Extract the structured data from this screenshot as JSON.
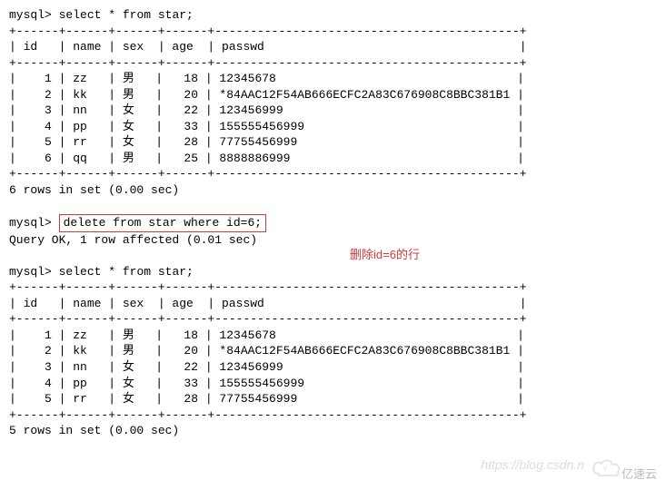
{
  "prompt": "mysql>",
  "queries": {
    "select1": "select * from star;",
    "delete": "delete from star where id=6;",
    "select2": "select * from star;"
  },
  "border": "+------+------+------+------+-------------------------------------------+",
  "header": "| id   | name | sex  | age  | passwd                                    |",
  "table1_rows": [
    "|    1 | zz   | 男   |   18 | 12345678                                  |",
    "|    2 | kk   | 男   |   20 | *84AAC12F54AB666ECFC2A83C676908C8BBC381B1 |",
    "|    3 | nn   | 女   |   22 | 123456999                                 |",
    "|    4 | pp   | 女   |   33 | 155555456999                              |",
    "|    5 | rr   | 女   |   28 | 77755456999                               |",
    "|    6 | qq   | 男   |   25 | 8888886999                                |"
  ],
  "result1": "6 rows in set (0.00 sec)",
  "delete_result": "Query OK, 1 row affected (0.01 sec)",
  "table2_rows": [
    "|    1 | zz   | 男   |   18 | 12345678                                  |",
    "|    2 | kk   | 男   |   20 | *84AAC12F54AB666ECFC2A83C676908C8BBC381B1 |",
    "|    3 | nn   | 女   |   22 | 123456999                                 |",
    "|    4 | pp   | 女   |   33 | 155555456999                              |",
    "|    5 | rr   | 女   |   28 | 77755456999                               |"
  ],
  "result2": "5 rows in set (0.00 sec)",
  "annotation": "删除id=6的行",
  "watermark_text": "https://blog.csdn.n",
  "watermark_logo": "亿速云",
  "chart_data": {
    "type": "table",
    "title": "star",
    "columns": [
      "id",
      "name",
      "sex",
      "age",
      "passwd"
    ],
    "before_delete": [
      {
        "id": 1,
        "name": "zz",
        "sex": "男",
        "age": 18,
        "passwd": "12345678"
      },
      {
        "id": 2,
        "name": "kk",
        "sex": "男",
        "age": 20,
        "passwd": "*84AAC12F54AB666ECFC2A83C676908C8BBC381B1"
      },
      {
        "id": 3,
        "name": "nn",
        "sex": "女",
        "age": 22,
        "passwd": "123456999"
      },
      {
        "id": 4,
        "name": "pp",
        "sex": "女",
        "age": 33,
        "passwd": "155555456999"
      },
      {
        "id": 5,
        "name": "rr",
        "sex": "女",
        "age": 28,
        "passwd": "77755456999"
      },
      {
        "id": 6,
        "name": "qq",
        "sex": "男",
        "age": 25,
        "passwd": "8888886999"
      }
    ],
    "after_delete": [
      {
        "id": 1,
        "name": "zz",
        "sex": "男",
        "age": 18,
        "passwd": "12345678"
      },
      {
        "id": 2,
        "name": "kk",
        "sex": "男",
        "age": 20,
        "passwd": "*84AAC12F54AB666ECFC2A83C676908C8BBC381B1"
      },
      {
        "id": 3,
        "name": "nn",
        "sex": "女",
        "age": 22,
        "passwd": "123456999"
      },
      {
        "id": 4,
        "name": "pp",
        "sex": "女",
        "age": 33,
        "passwd": "155555456999"
      },
      {
        "id": 5,
        "name": "rr",
        "sex": "女",
        "age": 28,
        "passwd": "77755456999"
      }
    ],
    "delete_condition": "id=6"
  }
}
